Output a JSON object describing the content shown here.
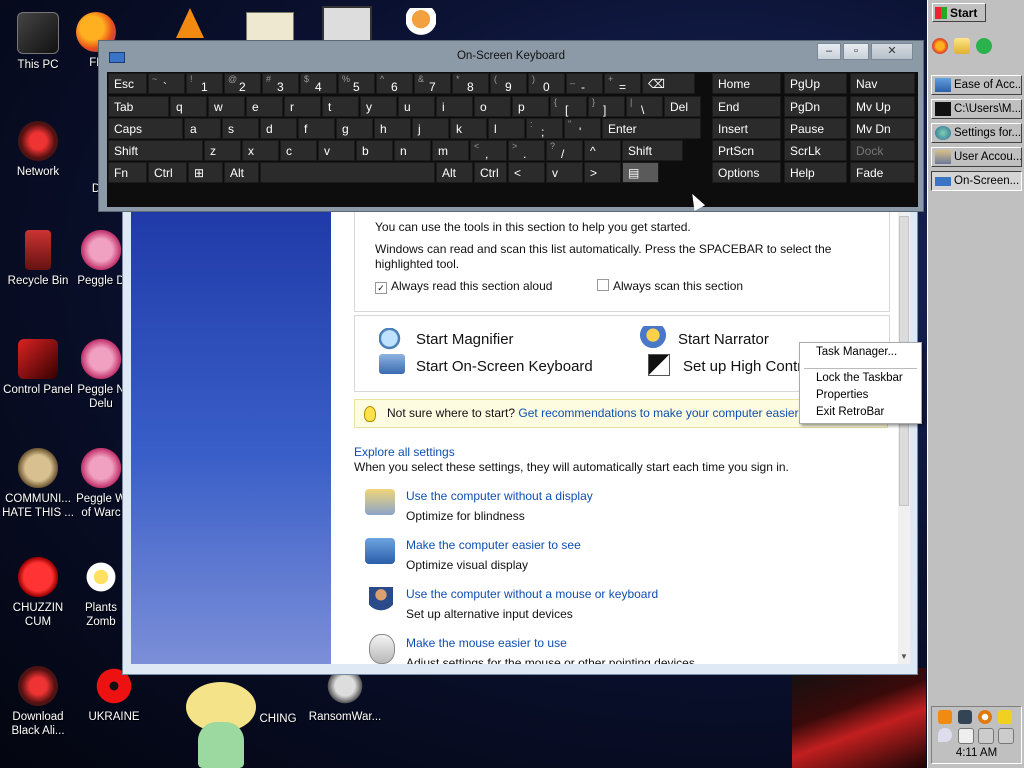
{
  "desktop": {
    "icons": [
      {
        "label": "This PC"
      },
      {
        "label": "Network"
      },
      {
        "label": "Recycle Bin"
      },
      {
        "label": "Control Panel"
      },
      {
        "label": "COMMUNI... HATE THIS ..."
      },
      {
        "label": "CHUZZIN CUM"
      },
      {
        "label": "Download Black Ali..."
      },
      {
        "label": "FL"
      },
      {
        "label": "D"
      },
      {
        "label": "Peggle D"
      },
      {
        "label": "Peggle N Delu"
      },
      {
        "label": "Peggle W of Warc"
      },
      {
        "label": "Plants Zomb"
      },
      {
        "label": "UKRAINE"
      },
      {
        "label": "CHING"
      },
      {
        "label": "RansomWar..."
      }
    ]
  },
  "taskbar": {
    "start_label": "Start",
    "buttons": [
      {
        "label": "Ease of Acc..."
      },
      {
        "label": "C:\\Users\\M..."
      },
      {
        "label": "Settings for..."
      },
      {
        "label": "User Accou..."
      },
      {
        "label": "On-Screen..."
      }
    ],
    "clock": "4:11 AM"
  },
  "osk": {
    "title": "On-Screen Keyboard",
    "rows": [
      [
        {
          "t": "Esc"
        },
        {
          "s": "~",
          "m": "`"
        },
        {
          "s": "!",
          "m": "1"
        },
        {
          "s": "@",
          "m": "2"
        },
        {
          "s": "#",
          "m": "3"
        },
        {
          "s": "$",
          "m": "4"
        },
        {
          "s": "%",
          "m": "5"
        },
        {
          "s": "^",
          "m": "6"
        },
        {
          "s": "&",
          "m": "7"
        },
        {
          "s": "*",
          "m": "8"
        },
        {
          "s": "(",
          "m": "9"
        },
        {
          "s": ")",
          "m": "0"
        },
        {
          "s": "_",
          "m": "-"
        },
        {
          "s": "+",
          "m": "="
        },
        {
          "t": "⌫"
        }
      ],
      [
        {
          "t": "Tab"
        },
        {
          "t": "q"
        },
        {
          "t": "w"
        },
        {
          "t": "e"
        },
        {
          "t": "r"
        },
        {
          "t": "t"
        },
        {
          "t": "y"
        },
        {
          "t": "u"
        },
        {
          "t": "i"
        },
        {
          "t": "o"
        },
        {
          "t": "p"
        },
        {
          "s": "{",
          "m": "["
        },
        {
          "s": "}",
          "m": "]"
        },
        {
          "s": "|",
          "m": "\\"
        },
        {
          "t": "Del"
        }
      ],
      [
        {
          "t": "Caps"
        },
        {
          "t": "a"
        },
        {
          "t": "s"
        },
        {
          "t": "d"
        },
        {
          "t": "f"
        },
        {
          "t": "g"
        },
        {
          "t": "h"
        },
        {
          "t": "j"
        },
        {
          "t": "k"
        },
        {
          "t": "l"
        },
        {
          "s": ":",
          "m": ";"
        },
        {
          "s": "\"",
          "m": "'"
        },
        {
          "t": "Enter"
        }
      ],
      [
        {
          "t": "Shift"
        },
        {
          "t": "z"
        },
        {
          "t": "x"
        },
        {
          "t": "c"
        },
        {
          "t": "v"
        },
        {
          "t": "b"
        },
        {
          "t": "n"
        },
        {
          "t": "m"
        },
        {
          "s": "<",
          "m": ","
        },
        {
          "s": ">",
          "m": "."
        },
        {
          "s": "?",
          "m": "/"
        },
        {
          "t": "^"
        },
        {
          "t": "Shift"
        }
      ],
      [
        {
          "t": "Fn"
        },
        {
          "t": "Ctrl"
        },
        {
          "t": "⊞"
        },
        {
          "t": "Alt"
        },
        {
          "t": ""
        },
        {
          "t": "Alt"
        },
        {
          "t": "Ctrl"
        },
        {
          "t": "<"
        },
        {
          "t": "v"
        },
        {
          "t": ">"
        },
        {
          "t": "▤"
        }
      ]
    ],
    "nav": [
      [
        "Home",
        "PgUp",
        "Nav"
      ],
      [
        "End",
        "PgDn",
        "Mv Up"
      ],
      [
        "Insert",
        "Pause",
        "Mv Dn"
      ],
      [
        "PrtScn",
        "ScrLk",
        "Dock"
      ],
      [
        "Options",
        "Help",
        "Fade"
      ]
    ]
  },
  "ease": {
    "intro": "You can use the tools in this section to help you get started.",
    "scan1": "Windows can read and scan this list automatically.  Press the SPACEBAR to select the",
    "scan2": "highlighted tool.",
    "always_read": "Always read this section aloud",
    "always_scan": "Always scan this section",
    "start_magnifier": "Start Magnifier",
    "start_narrator": "Start Narrator",
    "start_osk": "Start On-Screen Keyboard",
    "setup_contrast": "Set up High Contr",
    "tip_prefix": "Not sure where to start?",
    "tip_link": "Get recommendations to make your computer easier",
    "explore": "Explore all settings",
    "explore_desc": "When you select these settings, they will automatically start each time you sign in.",
    "items": [
      {
        "link": "Use the computer without a display",
        "desc": "Optimize for blindness"
      },
      {
        "link": "Make the computer easier to see",
        "desc": "Optimize visual display"
      },
      {
        "link": "Use the computer without a mouse or keyboard",
        "desc": "Set up alternative input devices"
      },
      {
        "link": "Make the mouse easier to use",
        "desc": "Adjust settings for the mouse or other pointing devices"
      }
    ]
  },
  "context_menu": {
    "task_manager": "Task Manager...",
    "lock_taskbar": "Lock the Taskbar",
    "properties": "Properties",
    "exit": "Exit RetroBar"
  }
}
